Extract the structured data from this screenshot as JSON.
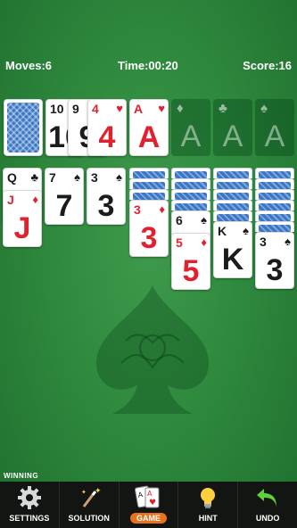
{
  "stats": {
    "moves": "Moves:6",
    "time": "Time:00:20",
    "score": "Score:16"
  },
  "stock": {
    "label": "stock-pile"
  },
  "waste": [
    {
      "rank": "10",
      "suit": "♠",
      "color": "black"
    },
    {
      "rank": "9",
      "suit": "♠",
      "color": "black"
    },
    {
      "rank": "4",
      "suit": "♥",
      "color": "red"
    }
  ],
  "foundations": [
    {
      "rank": "A",
      "suit": "♥",
      "color": "red",
      "filled": true
    },
    {
      "rank": "A",
      "suit": "♦",
      "filled": false
    },
    {
      "rank": "A",
      "suit": "♣",
      "filled": false
    },
    {
      "rank": "A",
      "suit": "♠",
      "filled": false
    }
  ],
  "tableau": [
    {
      "hidden": 0,
      "face": [
        {
          "rank": "Q",
          "suit": "♣",
          "color": "black"
        },
        {
          "rank": "J",
          "suit": "♦",
          "color": "red"
        }
      ]
    },
    {
      "hidden": 0,
      "face": [
        {
          "rank": "7",
          "suit": "♠",
          "color": "black"
        }
      ]
    },
    {
      "hidden": 0,
      "face": [
        {
          "rank": "3",
          "suit": "♠",
          "color": "black"
        }
      ]
    },
    {
      "hidden": 3,
      "face": [
        {
          "rank": "3",
          "suit": "♦",
          "color": "red"
        }
      ]
    },
    {
      "hidden": 4,
      "face": [
        {
          "rank": "6",
          "suit": "♠",
          "color": "black"
        },
        {
          "rank": "5",
          "suit": "♦",
          "color": "red"
        }
      ]
    },
    {
      "hidden": 5,
      "face": [
        {
          "rank": "K",
          "suit": "♠",
          "color": "black"
        }
      ]
    },
    {
      "hidden": 6,
      "face": [
        {
          "rank": "3",
          "suit": "♠",
          "color": "black"
        }
      ]
    }
  ],
  "winning_label": "WINNING",
  "toolbar": {
    "settings": "SETTINGS",
    "solution": "SOLUTION",
    "game": "GAME",
    "hint": "HINT",
    "undo": "UNDO"
  },
  "colors": {
    "felt": "#2f8a3e",
    "red": "#e0222f",
    "accent": "#e8731c",
    "card_back": "#3a76c4"
  }
}
